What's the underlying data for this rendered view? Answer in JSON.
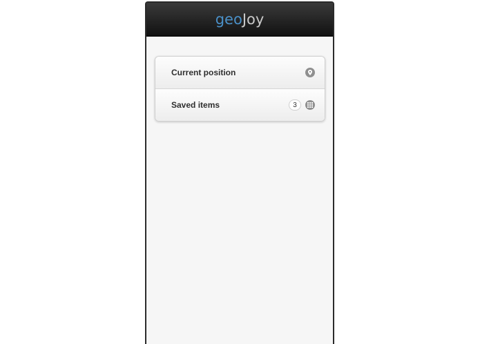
{
  "header": {
    "logo_geo": "geo",
    "logo_joy": "Joy"
  },
  "menu": {
    "items": [
      {
        "label": "Current position",
        "icon": "location-pin-icon"
      },
      {
        "label": "Saved items",
        "count": "3",
        "icon": "grid-icon"
      }
    ]
  },
  "colors": {
    "logo_geo": "#4a90c8",
    "logo_joy": "#c9c9c9",
    "header_bg": "#1a1a1a",
    "content_bg": "#f6f6f6",
    "icon_gray": "#8f8f8f"
  }
}
